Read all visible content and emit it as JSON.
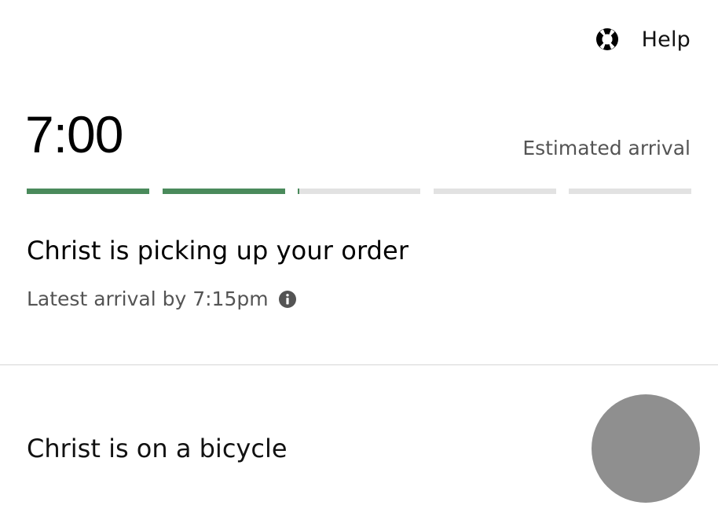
{
  "header": {
    "help_label": "Help",
    "help_icon": "lifebuoy-icon"
  },
  "eta": {
    "time": "7:00",
    "caption": "Estimated arrival"
  },
  "progress": {
    "segment_fills": [
      1,
      1,
      0.01,
      0,
      0,
      0
    ],
    "complete_color": "#4a8a5b",
    "pending_color": "#e2e2e2"
  },
  "status": {
    "title": "Christ is picking up your order",
    "latest_arrival": "Latest arrival by 7:15pm",
    "info_icon": "info-icon"
  },
  "courier": {
    "vehicle_text": "Christ is on a bicycle",
    "avatar_color": "#8f8f8f"
  }
}
